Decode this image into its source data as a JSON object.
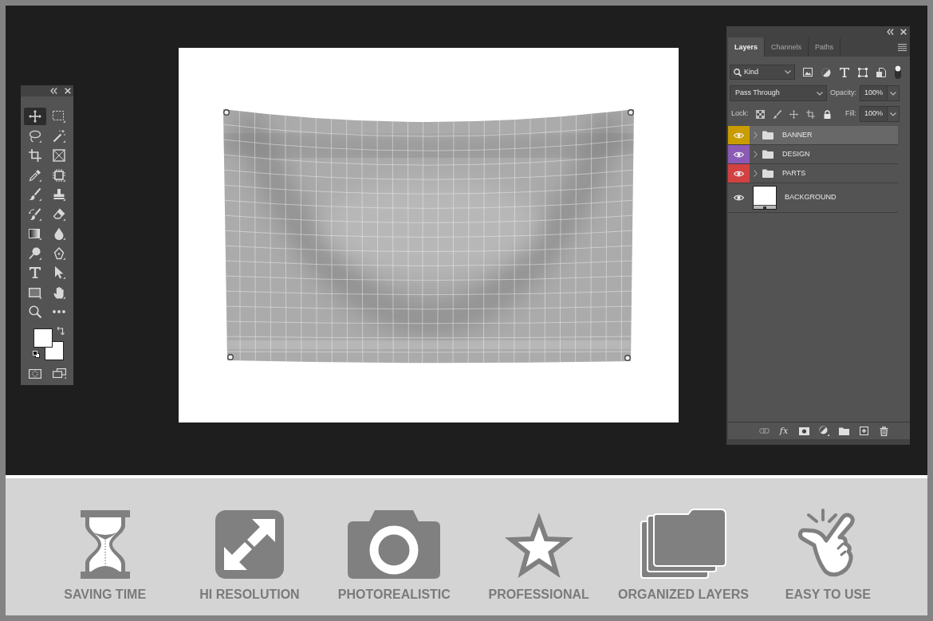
{
  "tools_panel": {
    "tools": [
      {
        "selected": true
      },
      {
        "selected": false
      },
      {
        "selected": false
      },
      {
        "selected": false
      },
      {
        "selected": false
      },
      {
        "selected": false
      },
      {
        "selected": false
      },
      {
        "selected": false
      },
      {
        "selected": false
      },
      {
        "selected": false
      },
      {
        "selected": false
      },
      {
        "selected": false
      },
      {
        "selected": false
      },
      {
        "selected": false
      },
      {
        "selected": false
      },
      {
        "selected": false
      },
      {
        "selected": false
      },
      {
        "selected": false
      },
      {
        "selected": false
      },
      {
        "selected": false
      },
      {
        "selected": false
      },
      {
        "selected": false
      }
    ]
  },
  "layers_panel": {
    "tabs": [
      {
        "label": "Layers",
        "selected": true
      },
      {
        "label": "Channels",
        "selected": false
      },
      {
        "label": "Paths",
        "selected": false
      }
    ],
    "filter": {
      "value": "Kind"
    },
    "blend_mode": {
      "value": "Pass Through"
    },
    "opacity": {
      "label": "Opacity:",
      "value": "100%"
    },
    "lock": {
      "label": "Lock:"
    },
    "fill": {
      "label": "Fill:",
      "value": "100%"
    },
    "layers": [
      {
        "name": "BANNER",
        "kind": "group",
        "expanded": false,
        "visible": true,
        "selected": true,
        "color": "#c99c00"
      },
      {
        "name": "DESIGN",
        "kind": "group",
        "expanded": false,
        "visible": true,
        "selected": false,
        "color": "#8a5ab5"
      },
      {
        "name": "PARTS",
        "kind": "group",
        "expanded": false,
        "visible": true,
        "selected": false,
        "color": "#d24141"
      },
      {
        "name": "BACKGROUND",
        "kind": "layer",
        "visible": true,
        "selected": false
      }
    ],
    "footer": {
      "style_button": "fx"
    }
  },
  "features": [
    {
      "label": "SAVING TIME"
    },
    {
      "label": "HI RESOLUTION"
    },
    {
      "label": "PHOTOREALISTIC"
    },
    {
      "label": "PROFESSIONAL"
    },
    {
      "label": "ORGANIZED LAYERS"
    },
    {
      "label": "EASY TO USE"
    }
  ]
}
